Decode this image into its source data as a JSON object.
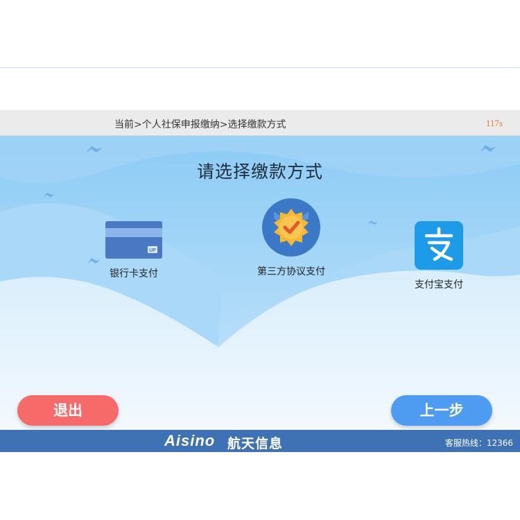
{
  "breadcrumb": "当前>个人社保申报缴纳>选择缴款方式",
  "countdown": "117s",
  "page_title": "请选择缴款方式",
  "options": [
    {
      "label": "银行卡支付",
      "icon": "bank-card-icon"
    },
    {
      "label": "第三方协议支付",
      "icon": "verified-badge-icon"
    },
    {
      "label": "支付宝支付",
      "icon": "alipay-icon"
    }
  ],
  "buttons": {
    "exit": "退出",
    "back": "上一步"
  },
  "footer": {
    "logo_en": "Aisino",
    "logo_cn": "航天信息",
    "hotline": "客服热线：12366"
  },
  "colors": {
    "accent_blue": "#4e9cf2",
    "exit_red": "#f66a6a",
    "footer_blue": "#3f71b5",
    "timer_orange": "#e67e22",
    "alipay_blue": "#1e9be8"
  }
}
